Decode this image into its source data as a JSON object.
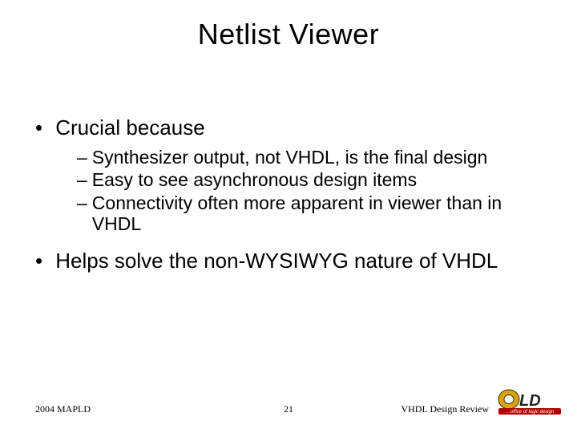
{
  "title": "Netlist Viewer",
  "bullets": {
    "b1": {
      "label": "Crucial because",
      "subs": [
        "Synthesizer output, not VHDL, is the final design",
        "Easy to see asynchronous design items",
        "Connectivity often more apparent in viewer than in VHDL"
      ]
    },
    "b2": {
      "label": "Helps solve the non-WYSIWYG nature of VHDL"
    }
  },
  "footer": {
    "left": "2004 MAPLD",
    "center": "21",
    "right": "VHDL Design Review"
  },
  "logo": {
    "tagline": "office of logic design"
  }
}
